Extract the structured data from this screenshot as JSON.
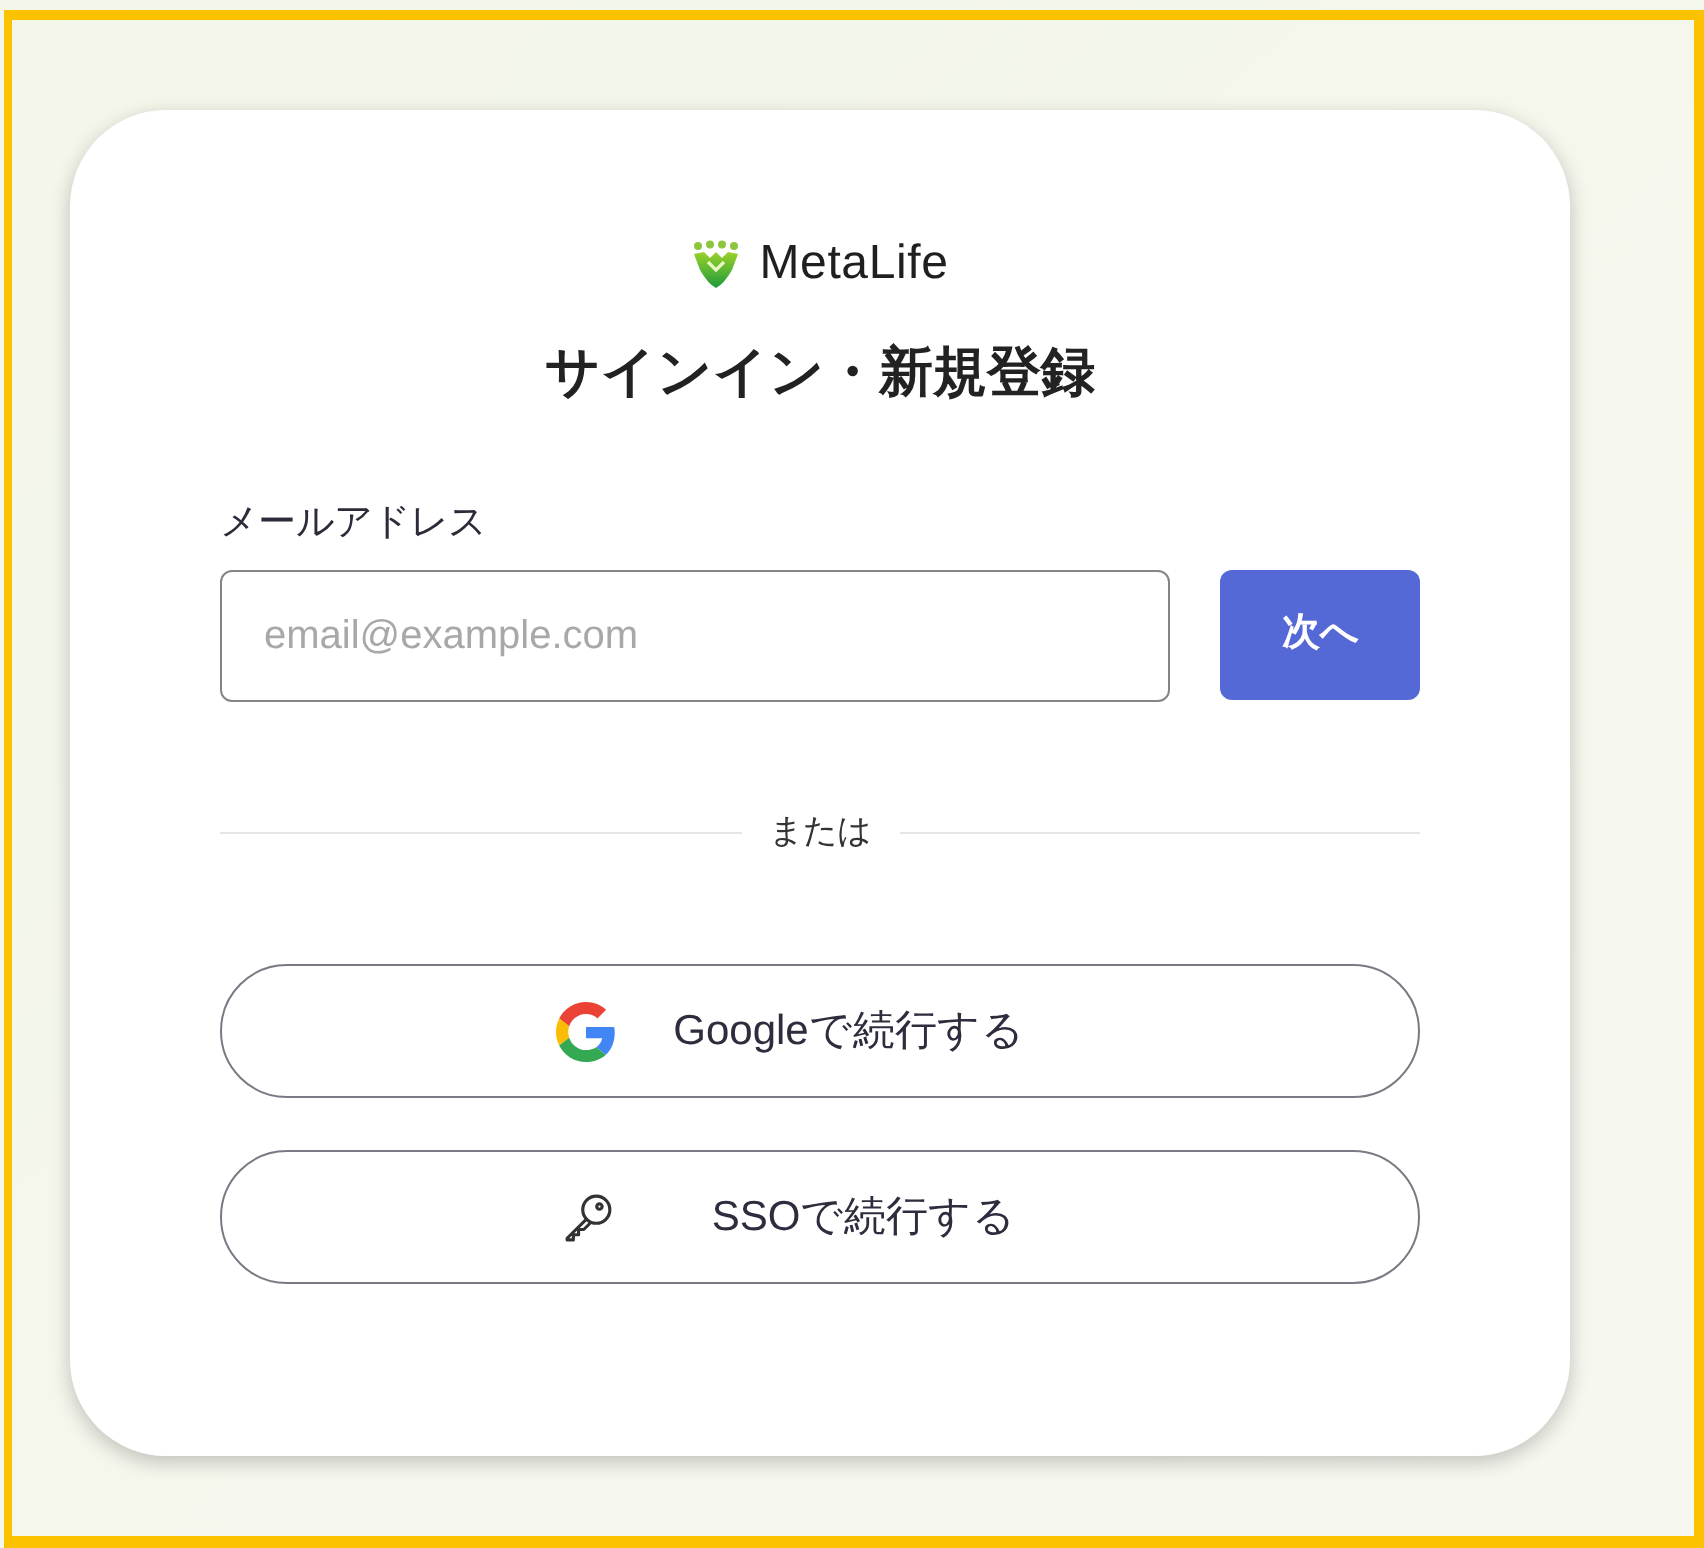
{
  "logo": {
    "text": "MetaLife"
  },
  "title": "サインイン・新規登録",
  "email": {
    "label": "メールアドレス",
    "placeholder": "email@example.com"
  },
  "next_button": {
    "label": "次へ"
  },
  "divider": {
    "label": "または"
  },
  "providers": [
    {
      "kind": "google",
      "label": "Googleで続行する"
    },
    {
      "kind": "sso",
      "label": "SSOで続行する"
    }
  ]
}
